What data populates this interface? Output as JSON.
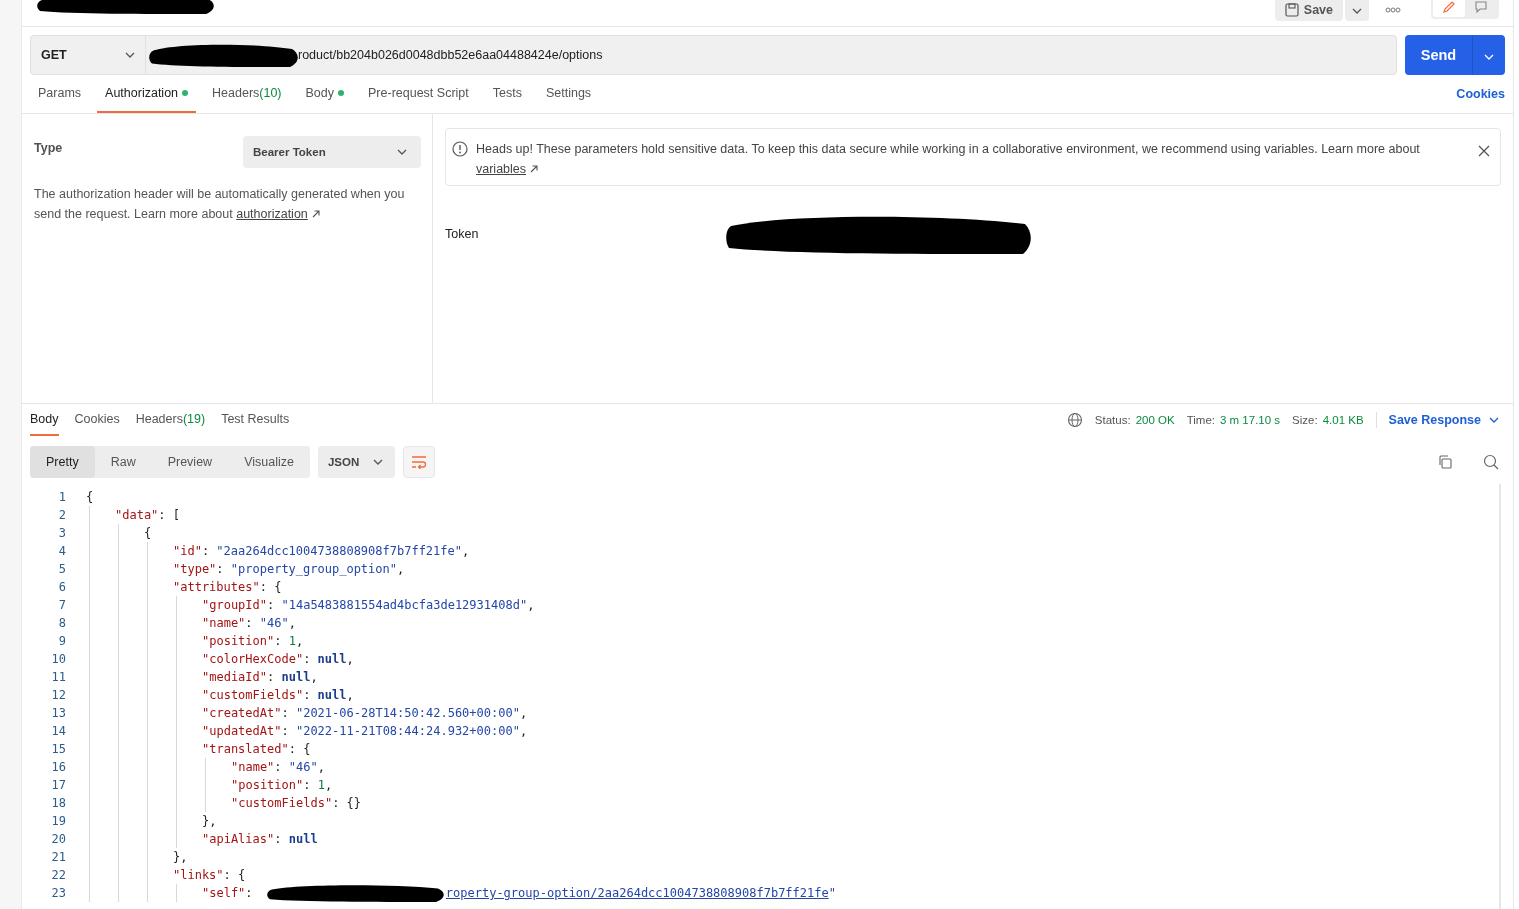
{
  "header": {
    "title_redacted": true,
    "save_label": "Save",
    "view_toggle": [
      {
        "kind": "edit",
        "selected": true
      },
      {
        "kind": "comment",
        "selected": false
      }
    ]
  },
  "request": {
    "method": "GET",
    "url_redacted": true,
    "url": "roduct/bb204b026d0048dbb52e6aa04488424e/options",
    "send_label": "Send"
  },
  "request_tabs": [
    {
      "label": "Params",
      "selected": false,
      "dot": false
    },
    {
      "label": "Authorization",
      "selected": true,
      "dot": true
    },
    {
      "label": "Headers",
      "count": "(10)",
      "selected": false,
      "dot": false
    },
    {
      "label": "Body",
      "selected": false,
      "dot": true
    },
    {
      "label": "Pre-request Script",
      "selected": false,
      "dot": false
    },
    {
      "label": "Tests",
      "selected": false,
      "dot": false
    },
    {
      "label": "Settings",
      "selected": false,
      "dot": false
    }
  ],
  "cookies_link": "Cookies",
  "auth": {
    "type_label": "Type",
    "type_value": "Bearer Token",
    "help": "The authorization header will be automatically generated when you send the request. Learn more about",
    "help_link": "authorization",
    "notice": "Heads up! These parameters hold sensitive data. To keep this data secure while working in a collaborative environment, we recommend using variables. Learn more about",
    "notice_link": "variables",
    "token_label": "Token",
    "token_redacted": true
  },
  "response_tabs": [
    {
      "label": "Body",
      "selected": true
    },
    {
      "label": "Cookies",
      "selected": false
    },
    {
      "label": "Headers",
      "count": "(19)",
      "selected": false
    },
    {
      "label": "Test Results",
      "selected": false
    }
  ],
  "status": [
    {
      "label": "Status:",
      "value": "200 OK"
    },
    {
      "label": "Time:",
      "value": "3 m 17.10 s"
    },
    {
      "label": "Size:",
      "value": "4.01 KB"
    }
  ],
  "save_response": "Save Response",
  "view_modes": [
    {
      "label": "Pretty",
      "selected": true
    },
    {
      "label": "Raw",
      "selected": false
    },
    {
      "label": "Preview",
      "selected": false
    },
    {
      "label": "Visualize",
      "selected": false
    }
  ],
  "format": "JSON",
  "code": [
    {
      "n": "1",
      "tokens": [
        {
          "kind": "punct",
          "text": "{"
        }
      ],
      "children": [
        {
          "n": "2",
          "tokens": [
            {
              "kind": "key",
              "text": "\"data\""
            },
            {
              "kind": "punct",
              "text": ": ["
            }
          ],
          "children": [
            {
              "n": "3",
              "tokens": [
                {
                  "kind": "punct",
                  "text": "{"
                }
              ],
              "children": [
                {
                  "n": "4",
                  "tokens": [
                    {
                      "kind": "key",
                      "text": "\"id\""
                    },
                    {
                      "kind": "punct",
                      "text": ": "
                    },
                    {
                      "kind": "str",
                      "text": "\"2aa264dcc1004738808908f7b7ff21fe\""
                    },
                    {
                      "kind": "punct",
                      "text": ","
                    }
                  ]
                },
                {
                  "n": "5",
                  "tokens": [
                    {
                      "kind": "key",
                      "text": "\"type\""
                    },
                    {
                      "kind": "punct",
                      "text": ": "
                    },
                    {
                      "kind": "str",
                      "text": "\"property_group_option\""
                    },
                    {
                      "kind": "punct",
                      "text": ","
                    }
                  ]
                },
                {
                  "n": "6",
                  "tokens": [
                    {
                      "kind": "key",
                      "text": "\"attributes\""
                    },
                    {
                      "kind": "punct",
                      "text": ": {"
                    }
                  ],
                  "children": [
                    {
                      "n": "7",
                      "tokens": [
                        {
                          "kind": "key",
                          "text": "\"groupId\""
                        },
                        {
                          "kind": "punct",
                          "text": ": "
                        },
                        {
                          "kind": "str",
                          "text": "\"14a5483881554ad4bcfa3de12931408d\""
                        },
                        {
                          "kind": "punct",
                          "text": ","
                        }
                      ]
                    },
                    {
                      "n": "8",
                      "tokens": [
                        {
                          "kind": "key",
                          "text": "\"name\""
                        },
                        {
                          "kind": "punct",
                          "text": ": "
                        },
                        {
                          "kind": "str",
                          "text": "\"46\""
                        },
                        {
                          "kind": "punct",
                          "text": ","
                        }
                      ]
                    },
                    {
                      "n": "9",
                      "tokens": [
                        {
                          "kind": "key",
                          "text": "\"position\""
                        },
                        {
                          "kind": "punct",
                          "text": ": "
                        },
                        {
                          "kind": "num",
                          "text": "1"
                        },
                        {
                          "kind": "punct",
                          "text": ","
                        }
                      ]
                    },
                    {
                      "n": "10",
                      "tokens": [
                        {
                          "kind": "key",
                          "text": "\"colorHexCode\""
                        },
                        {
                          "kind": "punct",
                          "text": ": "
                        },
                        {
                          "kind": "null",
                          "text": "null"
                        },
                        {
                          "kind": "punct",
                          "text": ","
                        }
                      ]
                    },
                    {
                      "n": "11",
                      "tokens": [
                        {
                          "kind": "key",
                          "text": "\"mediaId\""
                        },
                        {
                          "kind": "punct",
                          "text": ": "
                        },
                        {
                          "kind": "null",
                          "text": "null"
                        },
                        {
                          "kind": "punct",
                          "text": ","
                        }
                      ]
                    },
                    {
                      "n": "12",
                      "tokens": [
                        {
                          "kind": "key",
                          "text": "\"customFields\""
                        },
                        {
                          "kind": "punct",
                          "text": ": "
                        },
                        {
                          "kind": "null",
                          "text": "null"
                        },
                        {
                          "kind": "punct",
                          "text": ","
                        }
                      ]
                    },
                    {
                      "n": "13",
                      "tokens": [
                        {
                          "kind": "key",
                          "text": "\"createdAt\""
                        },
                        {
                          "kind": "punct",
                          "text": ": "
                        },
                        {
                          "kind": "str",
                          "text": "\"2021-06-28T14:50:42.560+00:00\""
                        },
                        {
                          "kind": "punct",
                          "text": ","
                        }
                      ]
                    },
                    {
                      "n": "14",
                      "tokens": [
                        {
                          "kind": "key",
                          "text": "\"updatedAt\""
                        },
                        {
                          "kind": "punct",
                          "text": ": "
                        },
                        {
                          "kind": "str",
                          "text": "\"2022-11-21T08:44:24.932+00:00\""
                        },
                        {
                          "kind": "punct",
                          "text": ","
                        }
                      ]
                    },
                    {
                      "n": "15",
                      "tokens": [
                        {
                          "kind": "key",
                          "text": "\"translated\""
                        },
                        {
                          "kind": "punct",
                          "text": ": {"
                        }
                      ],
                      "children": [
                        {
                          "n": "16",
                          "tokens": [
                            {
                              "kind": "key",
                              "text": "\"name\""
                            },
                            {
                              "kind": "punct",
                              "text": ": "
                            },
                            {
                              "kind": "str",
                              "text": "\"46\""
                            },
                            {
                              "kind": "punct",
                              "text": ","
                            }
                          ]
                        },
                        {
                          "n": "17",
                          "tokens": [
                            {
                              "kind": "key",
                              "text": "\"position\""
                            },
                            {
                              "kind": "punct",
                              "text": ": "
                            },
                            {
                              "kind": "num",
                              "text": "1"
                            },
                            {
                              "kind": "punct",
                              "text": ","
                            }
                          ]
                        },
                        {
                          "n": "18",
                          "tokens": [
                            {
                              "kind": "key",
                              "text": "\"customFields\""
                            },
                            {
                              "kind": "punct",
                              "text": ": {}"
                            }
                          ]
                        }
                      ]
                    },
                    {
                      "n": "19",
                      "tokens": [
                        {
                          "kind": "punct",
                          "text": "},"
                        }
                      ]
                    },
                    {
                      "n": "20",
                      "tokens": [
                        {
                          "kind": "key",
                          "text": "\"apiAlias\""
                        },
                        {
                          "kind": "punct",
                          "text": ": "
                        },
                        {
                          "kind": "null",
                          "text": "null"
                        }
                      ]
                    }
                  ]
                },
                {
                  "n": "21",
                  "tokens": [
                    {
                      "kind": "punct",
                      "text": "},"
                    }
                  ]
                },
                {
                  "n": "22",
                  "tokens": [
                    {
                      "kind": "key",
                      "text": "\"links\""
                    },
                    {
                      "kind": "punct",
                      "text": ": {"
                    }
                  ],
                  "children": [
                    {
                      "n": "23",
                      "tokens": [
                        {
                          "kind": "key",
                          "text": "\"self\""
                        },
                        {
                          "kind": "punct",
                          "text": ": "
                        },
                        {
                          "kind": "redaction"
                        },
                        {
                          "kind": "link",
                          "text": "roperty-group-option/2aa264dcc1004738808908f7b7ff21fe"
                        },
                        {
                          "kind": "str",
                          "text": "\""
                        }
                      ]
                    }
                  ]
                }
              ]
            }
          ]
        }
      ]
    }
  ]
}
